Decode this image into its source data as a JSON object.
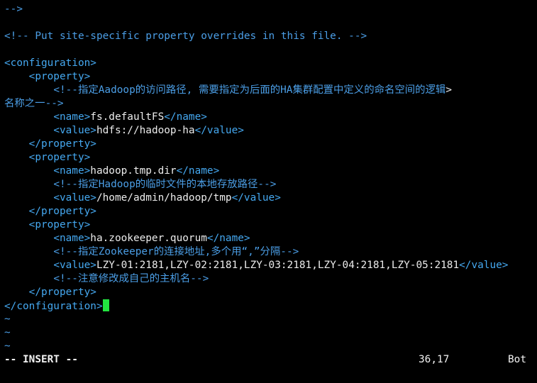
{
  "colors": {
    "tag": "#45a8f0",
    "text": "#ececec",
    "comment": "#4b9ee6",
    "tilde": "#4b9ee6",
    "cursor": "#22e640",
    "background": "#000000"
  },
  "editor": {
    "lines": [
      {
        "id": "line-comment-end",
        "parts": [
          {
            "t": "-->",
            "c": "cmt"
          }
        ]
      },
      {
        "id": "line-blank-1",
        "parts": []
      },
      {
        "id": "line-site-comment",
        "parts": [
          {
            "t": "<!-- Put site-specific property overrides in this file. -->",
            "c": "cmt"
          }
        ]
      },
      {
        "id": "line-blank-2",
        "parts": []
      },
      {
        "id": "line-config-open",
        "parts": [
          {
            "t": "<configuration>",
            "c": "tag"
          }
        ]
      },
      {
        "id": "line-property-open-1",
        "parts": [
          {
            "t": "    "
          },
          {
            "t": "<property>",
            "c": "tag"
          }
        ]
      },
      {
        "id": "line-comment-1a",
        "parts": [
          {
            "t": "        "
          },
          {
            "t": "<!--指定Aadoop的访问路径, 需要指定为后面的HA集群配置中定义的命名空间的逻辑",
            "c": "cmt"
          },
          {
            "t": ">",
            "c": "txt"
          }
        ]
      },
      {
        "id": "line-comment-1b",
        "parts": [
          {
            "t": "名称之一-->",
            "c": "cmt"
          }
        ]
      },
      {
        "id": "line-name-1",
        "parts": [
          {
            "t": "        "
          },
          {
            "t": "<name>",
            "c": "tag"
          },
          {
            "t": "fs.defaultFS",
            "c": "txt"
          },
          {
            "t": "</name>",
            "c": "tag"
          }
        ]
      },
      {
        "id": "line-value-1",
        "parts": [
          {
            "t": "        "
          },
          {
            "t": "<value>",
            "c": "tag"
          },
          {
            "t": "hdfs://hadoop-ha",
            "c": "txt"
          },
          {
            "t": "</value>",
            "c": "tag"
          }
        ]
      },
      {
        "id": "line-property-close-1",
        "parts": [
          {
            "t": "    "
          },
          {
            "t": "</property>",
            "c": "tag"
          }
        ]
      },
      {
        "id": "line-property-open-2",
        "parts": [
          {
            "t": "    "
          },
          {
            "t": "<property>",
            "c": "tag"
          }
        ]
      },
      {
        "id": "line-name-2",
        "parts": [
          {
            "t": "        "
          },
          {
            "t": "<name>",
            "c": "tag"
          },
          {
            "t": "hadoop.tmp.dir",
            "c": "txt"
          },
          {
            "t": "</name>",
            "c": "tag"
          }
        ]
      },
      {
        "id": "line-comment-2",
        "parts": [
          {
            "t": "        "
          },
          {
            "t": "<!--指定Hadoop的临时文件的本地存放路径-->",
            "c": "cmt"
          }
        ]
      },
      {
        "id": "line-value-2",
        "parts": [
          {
            "t": "        "
          },
          {
            "t": "<value>",
            "c": "tag"
          },
          {
            "t": "/home/admin/hadoop/tmp",
            "c": "txt"
          },
          {
            "t": "</value>",
            "c": "tag"
          }
        ]
      },
      {
        "id": "line-property-close-2",
        "parts": [
          {
            "t": "    "
          },
          {
            "t": "</property>",
            "c": "tag"
          }
        ]
      },
      {
        "id": "line-property-open-3",
        "parts": [
          {
            "t": "    "
          },
          {
            "t": "<property>",
            "c": "tag"
          }
        ]
      },
      {
        "id": "line-name-3",
        "parts": [
          {
            "t": "        "
          },
          {
            "t": "<name>",
            "c": "tag"
          },
          {
            "t": "ha.zookeeper.quorum",
            "c": "txt"
          },
          {
            "t": "</name>",
            "c": "tag"
          }
        ]
      },
      {
        "id": "line-comment-3",
        "parts": [
          {
            "t": "        "
          },
          {
            "t": "<!--指定Zookeeper的连接地址,多个用“,”分隔-->",
            "c": "cmt"
          }
        ]
      },
      {
        "id": "line-value-3",
        "parts": [
          {
            "t": "        "
          },
          {
            "t": "<value>",
            "c": "tag"
          },
          {
            "t": "LZY-01:2181,LZY-02:2181,LZY-03:2181,LZY-04:2181,LZY-05:2181",
            "c": "txt"
          },
          {
            "t": "</value>",
            "c": "tag"
          }
        ]
      },
      {
        "id": "line-comment-4",
        "parts": [
          {
            "t": "        "
          },
          {
            "t": "<!--注意修改成自己的主机名-->",
            "c": "cmt"
          }
        ]
      },
      {
        "id": "line-property-close-3",
        "parts": [
          {
            "t": "    "
          },
          {
            "t": "</property>",
            "c": "tag"
          }
        ]
      },
      {
        "id": "line-config-close",
        "parts": [
          {
            "t": "</configuration>",
            "c": "tag"
          }
        ],
        "cursor": true
      },
      {
        "id": "line-tilde-1",
        "parts": [
          {
            "t": "~",
            "c": "tilde"
          }
        ]
      },
      {
        "id": "line-tilde-2",
        "parts": [
          {
            "t": "~",
            "c": "tilde"
          }
        ]
      },
      {
        "id": "line-tilde-3",
        "parts": [
          {
            "t": "~",
            "c": "tilde"
          }
        ]
      }
    ]
  },
  "status_bar": {
    "mode": "-- INSERT --",
    "position": "36,17",
    "scroll": "Bot"
  }
}
